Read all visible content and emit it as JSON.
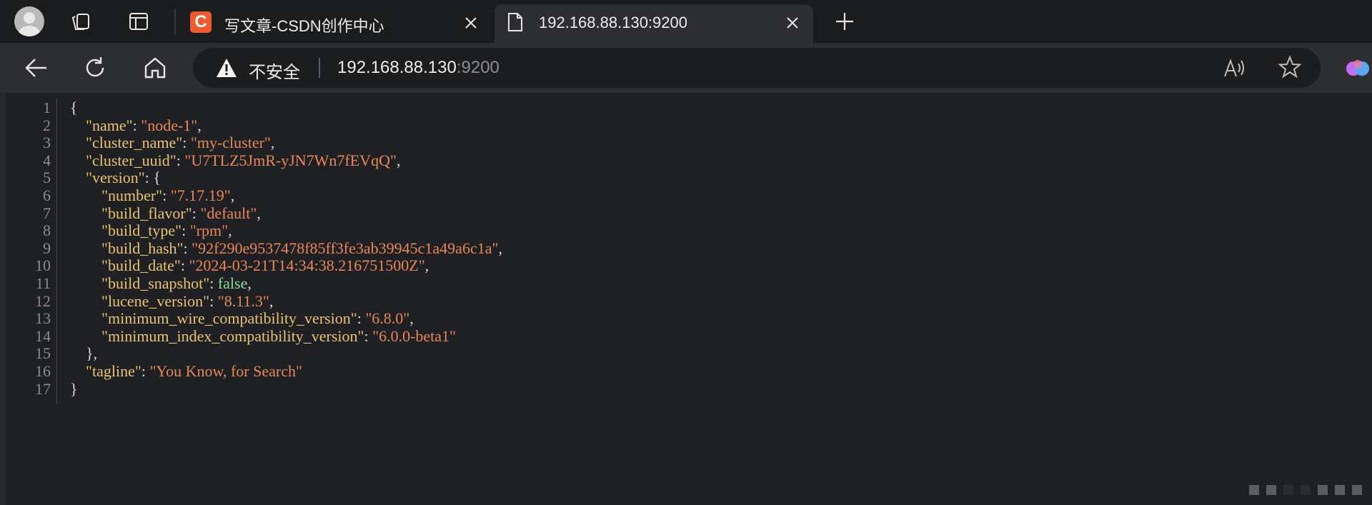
{
  "tabs": [
    {
      "title": "写文章-CSDN创作中心",
      "favicon": "C",
      "active": false
    },
    {
      "title": "192.168.88.130:9200",
      "active": true
    }
  ],
  "address_bar": {
    "security_label": "不安全",
    "url_host": "192.168.88.130",
    "url_port": ":9200"
  },
  "colors": {
    "key": "#e9c36b",
    "string": "#e88756",
    "boolean": "#8fdc92",
    "csdn_brand": "#f05a2d"
  },
  "json_view": {
    "lines": [
      [
        {
          "t": "p",
          "v": "{"
        }
      ],
      [
        {
          "t": "p",
          "v": "    "
        },
        {
          "t": "k",
          "v": "\"name\""
        },
        {
          "t": "p",
          "v": ": "
        },
        {
          "t": "s",
          "v": "\"node-1\""
        },
        {
          "t": "p",
          "v": ","
        }
      ],
      [
        {
          "t": "p",
          "v": "    "
        },
        {
          "t": "k",
          "v": "\"cluster_name\""
        },
        {
          "t": "p",
          "v": ": "
        },
        {
          "t": "s",
          "v": "\"my-cluster\""
        },
        {
          "t": "p",
          "v": ","
        }
      ],
      [
        {
          "t": "p",
          "v": "    "
        },
        {
          "t": "k",
          "v": "\"cluster_uuid\""
        },
        {
          "t": "p",
          "v": ": "
        },
        {
          "t": "s",
          "v": "\"U7TLZ5JmR-yJN7Wn7fEVqQ\""
        },
        {
          "t": "p",
          "v": ","
        }
      ],
      [
        {
          "t": "p",
          "v": "    "
        },
        {
          "t": "k",
          "v": "\"version\""
        },
        {
          "t": "p",
          "v": ": {"
        }
      ],
      [
        {
          "t": "p",
          "v": "        "
        },
        {
          "t": "k",
          "v": "\"number\""
        },
        {
          "t": "p",
          "v": ": "
        },
        {
          "t": "s",
          "v": "\"7.17.19\""
        },
        {
          "t": "p",
          "v": ","
        }
      ],
      [
        {
          "t": "p",
          "v": "        "
        },
        {
          "t": "k",
          "v": "\"build_flavor\""
        },
        {
          "t": "p",
          "v": ": "
        },
        {
          "t": "s",
          "v": "\"default\""
        },
        {
          "t": "p",
          "v": ","
        }
      ],
      [
        {
          "t": "p",
          "v": "        "
        },
        {
          "t": "k",
          "v": "\"build_type\""
        },
        {
          "t": "p",
          "v": ": "
        },
        {
          "t": "s",
          "v": "\"rpm\""
        },
        {
          "t": "p",
          "v": ","
        }
      ],
      [
        {
          "t": "p",
          "v": "        "
        },
        {
          "t": "k",
          "v": "\"build_hash\""
        },
        {
          "t": "p",
          "v": ": "
        },
        {
          "t": "s",
          "v": "\"92f290e9537478f85ff3fe3ab39945c1a49a6c1a\""
        },
        {
          "t": "p",
          "v": ","
        }
      ],
      [
        {
          "t": "p",
          "v": "        "
        },
        {
          "t": "k",
          "v": "\"build_date\""
        },
        {
          "t": "p",
          "v": ": "
        },
        {
          "t": "s",
          "v": "\"2024-03-21T14:34:38.216751500Z\""
        },
        {
          "t": "p",
          "v": ","
        }
      ],
      [
        {
          "t": "p",
          "v": "        "
        },
        {
          "t": "k",
          "v": "\"build_snapshot\""
        },
        {
          "t": "p",
          "v": ": "
        },
        {
          "t": "b",
          "v": "false"
        },
        {
          "t": "p",
          "v": ","
        }
      ],
      [
        {
          "t": "p",
          "v": "        "
        },
        {
          "t": "k",
          "v": "\"lucene_version\""
        },
        {
          "t": "p",
          "v": ": "
        },
        {
          "t": "s",
          "v": "\"8.11.3\""
        },
        {
          "t": "p",
          "v": ","
        }
      ],
      [
        {
          "t": "p",
          "v": "        "
        },
        {
          "t": "k",
          "v": "\"minimum_wire_compatibility_version\""
        },
        {
          "t": "p",
          "v": ": "
        },
        {
          "t": "s",
          "v": "\"6.8.0\""
        },
        {
          "t": "p",
          "v": ","
        }
      ],
      [
        {
          "t": "p",
          "v": "        "
        },
        {
          "t": "k",
          "v": "\"minimum_index_compatibility_version\""
        },
        {
          "t": "p",
          "v": ": "
        },
        {
          "t": "s",
          "v": "\"6.0.0-beta1\""
        }
      ],
      [
        {
          "t": "p",
          "v": "    },"
        }
      ],
      [
        {
          "t": "p",
          "v": "    "
        },
        {
          "t": "k",
          "v": "\"tagline\""
        },
        {
          "t": "p",
          "v": ": "
        },
        {
          "t": "s",
          "v": "\"You Know, for Search\""
        }
      ],
      [
        {
          "t": "p",
          "v": "}"
        }
      ]
    ],
    "line_numbers": [
      "1",
      "2",
      "3",
      "4",
      "5",
      "6",
      "7",
      "8",
      "9",
      "10",
      "11",
      "12",
      "13",
      "14",
      "15",
      "16",
      "17"
    ]
  }
}
